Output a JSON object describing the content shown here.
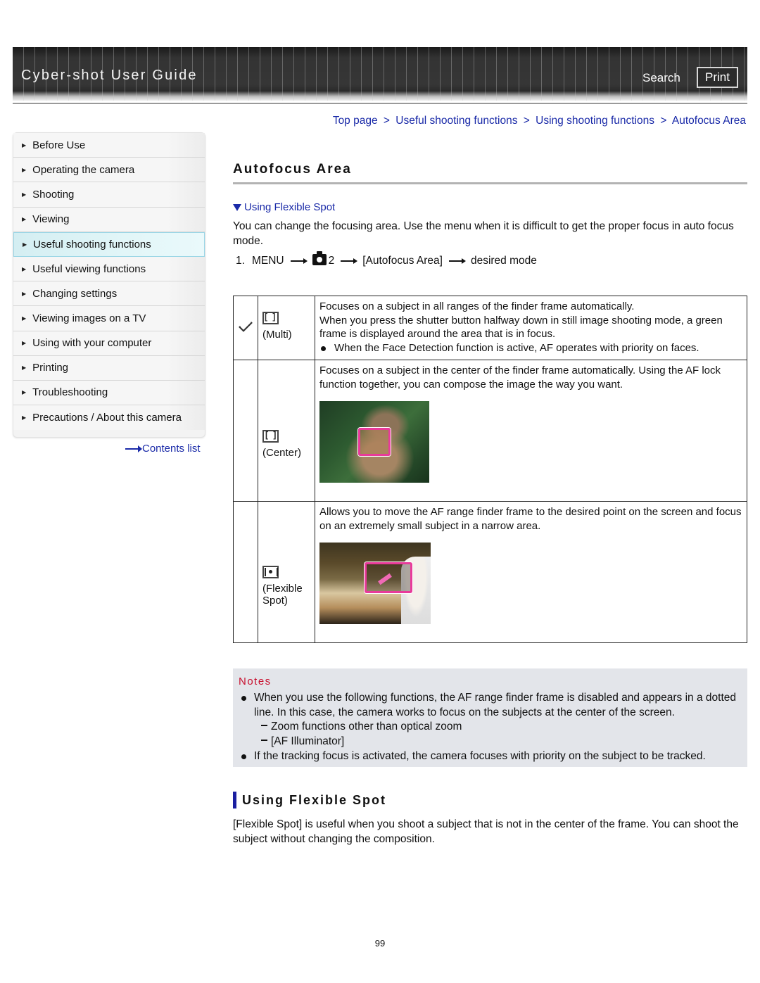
{
  "header": {
    "app_title": "Cyber-shot User Guide",
    "search_label": "Search",
    "print_label": "Print"
  },
  "breadcrumb": {
    "items": [
      "Top page",
      "Useful shooting functions",
      "Using shooting functions",
      "Autofocus Area"
    ],
    "separator": ">"
  },
  "sidebar": {
    "items": [
      {
        "label": "Before Use"
      },
      {
        "label": "Operating the camera"
      },
      {
        "label": "Shooting"
      },
      {
        "label": "Viewing"
      },
      {
        "label": "Useful shooting functions",
        "active": true
      },
      {
        "label": "Useful viewing functions"
      },
      {
        "label": "Changing settings"
      },
      {
        "label": "Viewing images on a TV"
      },
      {
        "label": "Using with your computer"
      },
      {
        "label": "Printing"
      },
      {
        "label": "Troubleshooting"
      },
      {
        "label": "Precautions / About this camera"
      }
    ],
    "contents_link": "Contents list"
  },
  "main": {
    "title": "Autofocus Area",
    "anchor_link": "Using Flexible Spot",
    "intro": "You can change the focusing area. Use the menu when it is difficult to get the proper focus in auto focus mode.",
    "step": {
      "number": "1.",
      "menu": "MENU",
      "camera_tab": "2",
      "item": "[Autofocus Area]",
      "target": "desired mode"
    },
    "modes": [
      {
        "icon": "multi-af-icon",
        "name": "(Multi)",
        "default": true,
        "lines": [
          "Focuses on a subject in all ranges of the finder frame automatically.",
          "When you press the shutter button halfway down in still image shooting mode, a green frame is displayed around the area that is in focus."
        ],
        "bullet": "When the Face Detection function is active, AF operates with priority on faces."
      },
      {
        "icon": "center-af-icon",
        "name": "(Center)",
        "default": false,
        "lines": [
          "Focuses on a subject in the center of the finder frame automatically. Using the AF lock function together, you can compose the image the way you want."
        ],
        "image": "cat-center-af-photo"
      },
      {
        "icon": "flexible-spot-af-icon",
        "name_line1": "(Flexible",
        "name_line2": "Spot)",
        "default": false,
        "lines": [
          "Allows you to move the AF range finder frame to the desired point on the screen and focus on an extremely small subject in a narrow area."
        ],
        "image": "cat-flexible-spot-photo"
      }
    ],
    "notes": {
      "title": "Notes",
      "items": [
        {
          "text": "When you use the following functions, the AF range finder frame is disabled and appears in a dotted line. In this case, the camera works to focus on the subjects at the center of the screen.",
          "subitems": [
            "Zoom functions other than optical zoom",
            "[AF Illuminator]"
          ]
        },
        {
          "text": "If the tracking focus is activated, the camera focuses with priority on the subject to be tracked."
        }
      ]
    },
    "section": {
      "heading": "Using Flexible Spot",
      "body": "[Flexible Spot] is useful when you shoot a subject that is not in the center of the frame. You can shoot the subject without changing the composition."
    },
    "page_number": "99"
  },
  "colors": {
    "link": "#1a2aa8",
    "notes_title": "#c8102e",
    "notes_bg": "#e3e5ea",
    "section_bar": "#1a1ea0",
    "af_frame": "#e83a9a"
  }
}
